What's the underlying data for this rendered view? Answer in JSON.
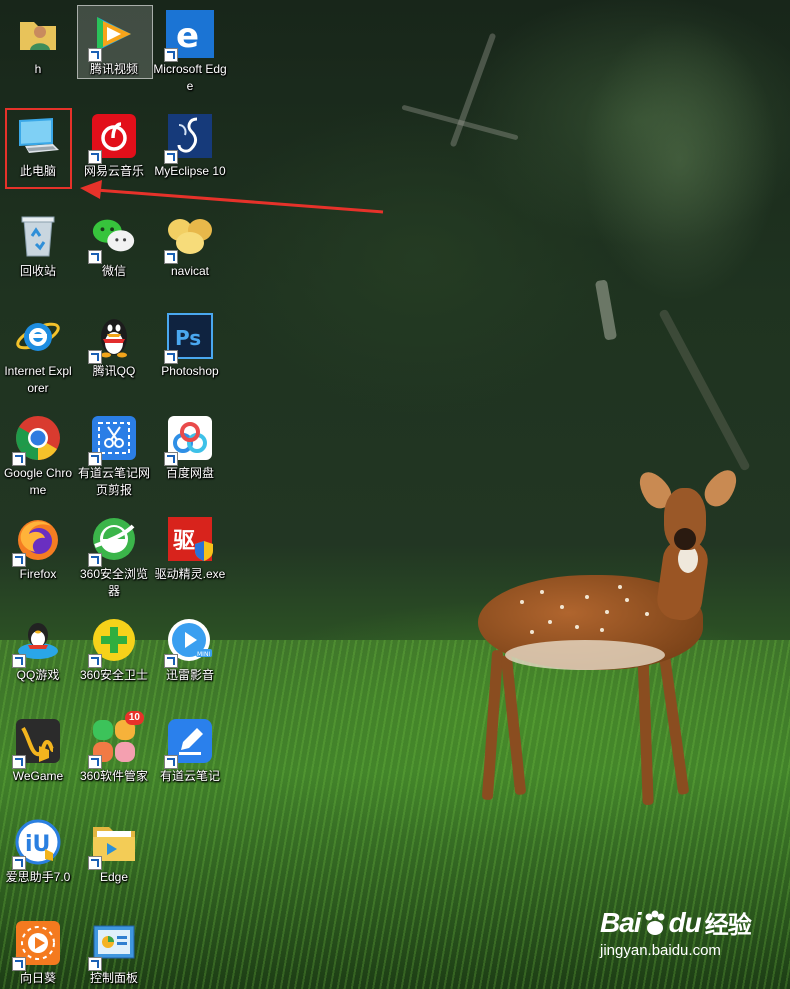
{
  "desktop": {
    "icons": [
      {
        "label": "h",
        "icon": "user-folder-icon",
        "shortcut": false
      },
      {
        "label": "腾讯视频",
        "icon": "tencent-video-icon",
        "shortcut": true
      },
      {
        "label": "Microsoft Edge",
        "icon": "edge-icon",
        "shortcut": true
      },
      {
        "label": "此电脑",
        "icon": "this-pc-icon",
        "shortcut": false
      },
      {
        "label": "网易云音乐",
        "icon": "netease-music-icon",
        "shortcut": true
      },
      {
        "label": "MyEclipse 10",
        "icon": "myeclipse-icon",
        "shortcut": true
      },
      {
        "label": "回收站",
        "icon": "recycle-bin-icon",
        "shortcut": false
      },
      {
        "label": "微信",
        "icon": "wechat-icon",
        "shortcut": true
      },
      {
        "label": "navicat",
        "icon": "navicat-icon",
        "shortcut": true
      },
      {
        "label": "Internet Explorer",
        "icon": "ie-icon",
        "shortcut": false
      },
      {
        "label": "腾讯QQ",
        "icon": "qq-icon",
        "shortcut": true
      },
      {
        "label": "Photoshop",
        "icon": "photoshop-icon",
        "shortcut": true
      },
      {
        "label": "Google Chrome",
        "icon": "chrome-icon",
        "shortcut": true
      },
      {
        "label": "有道云笔记网页剪报",
        "icon": "youdao-clipper-icon",
        "shortcut": true
      },
      {
        "label": "百度网盘",
        "icon": "baidu-netdisk-icon",
        "shortcut": true
      },
      {
        "label": "Firefox",
        "icon": "firefox-icon",
        "shortcut": true
      },
      {
        "label": "360安全浏览器",
        "icon": "360-browser-icon",
        "shortcut": true
      },
      {
        "label": "驱动精灵.exe",
        "icon": "driver-genius-icon",
        "shortcut": true
      },
      {
        "label": "QQ游戏",
        "icon": "qq-game-icon",
        "shortcut": true
      },
      {
        "label": "360安全卫士",
        "icon": "360-safe-icon",
        "shortcut": true
      },
      {
        "label": "迅雷影音",
        "icon": "xunlei-player-icon",
        "shortcut": true
      },
      {
        "label": "WeGame",
        "icon": "wegame-icon",
        "shortcut": true
      },
      {
        "label": "360软件管家",
        "icon": "360-software-icon",
        "shortcut": true,
        "badge": "10"
      },
      {
        "label": "有道云笔记",
        "icon": "youdao-note-icon",
        "shortcut": true
      },
      {
        "label": "爱思助手7.0",
        "icon": "aisi-icon",
        "shortcut": true
      },
      {
        "label": "Edge",
        "icon": "edge-folder-icon",
        "shortcut": true
      },
      {
        "label": "向日葵",
        "icon": "sunflower-icon",
        "shortcut": true
      },
      {
        "label": "控制面板",
        "icon": "control-panel-icon",
        "shortcut": true
      }
    ],
    "highlighted": "此电脑",
    "selected": "腾讯视频"
  },
  "watermark": {
    "brand": "Bai",
    "brand_suffix": "du",
    "cn": "经验",
    "url": "jingyan.baidu.com"
  },
  "colors": {
    "highlight_box": "#e6322a",
    "arrow": "#e6322a"
  }
}
